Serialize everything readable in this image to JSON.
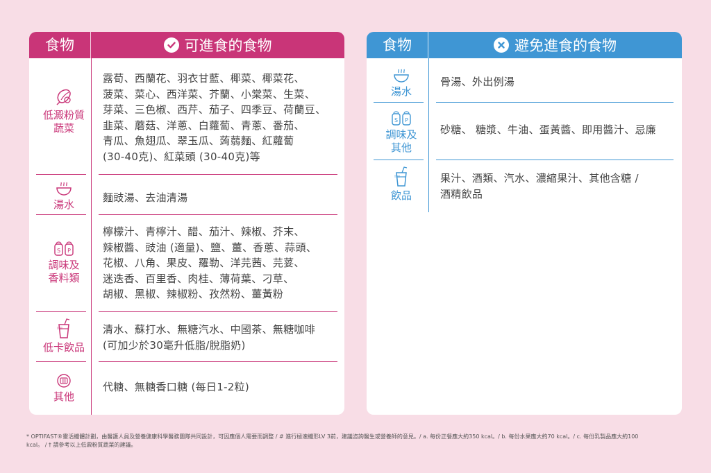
{
  "allowed": {
    "header_food": "食物",
    "header_title": "可進食的食物",
    "rows": [
      {
        "category": "低澱粉質\n蔬菜",
        "icon": "vegetable-icon",
        "text": "露荀、西蘭花、羽衣甘藍、椰菜、椰菜花、\n菠菜、菜心、西洋菜、芥蘭、小棠菜、生菜、\n芽菜、三色椒、西芹、茄子、四季豆、荷蘭豆、\n韭菜、蘑菇、洋蔥、白蘿蔔、青蔥、番茄、\n青瓜、魚翅瓜、翠玉瓜、蒟蒻麵、紅蘿蔔\n(30-40克)、紅菜頭 (30-40克)等"
      },
      {
        "category": "湯水",
        "icon": "soup-bowl-icon",
        "text": "麵豉湯、去油清湯"
      },
      {
        "category": "調味及\n香料類",
        "icon": "salt-pepper-icon",
        "text": "檸檬汁、青檸汁、醋、茄汁、辣椒、芥末、\n辣椒醬、豉油 (適量)、鹽、薑、香蔥、蒜頭、\n花椒、八角、果皮、羅勒、洋芫茜、芫荽、\n迷迭香、百里香、肉桂、薄荷葉、刁草、\n胡椒、黑椒、辣椒粉、孜然粉、薑黃粉"
      },
      {
        "category": "低卡飲品",
        "icon": "drink-icon",
        "text": "清水、蘇打水、無糖汽水、中國茶、無糖咖啡\n(可加少於30毫升低脂/脫脂奶)"
      },
      {
        "category": "其他",
        "icon": "gum-icon",
        "text": "代糖、無糖香口糖 (每日1-2粒)"
      }
    ]
  },
  "avoid": {
    "header_food": "食物",
    "header_title": "避免進食的食物",
    "rows": [
      {
        "category": "湯水",
        "icon": "soup-bowl-icon",
        "text": "骨湯、外出例湯"
      },
      {
        "category": "調味及\n其他",
        "icon": "salt-pepper-icon",
        "text": "砂糖、 糖漿、牛油、蛋黃醬、即用醬汁、忌廉"
      },
      {
        "category": "飲品",
        "icon": "drink-icon",
        "text": "果汁、酒類、汽水、濃縮果汁、其他含糖 /\n酒精飲品"
      }
    ]
  },
  "footnote": "* OPTIFAST®靈活纖體計劃，由醫護人員及營養健康科學醫務團隊共同設計，可因應個人需要而調整 / # 進行極速纖形LV 3前，建議咨詢醫生或營養師的意見。/ a. 每份正餐應大約350 kcal。/ b. 每份水果應大約70 kcal。/ c. 每份乳製品應大約100 kcal。 / † 請參考以上低澱粉質蔬菜的建議。",
  "colors": {
    "pink": "#c93578",
    "blue": "#3f96d4",
    "background": "#f8dde6"
  }
}
